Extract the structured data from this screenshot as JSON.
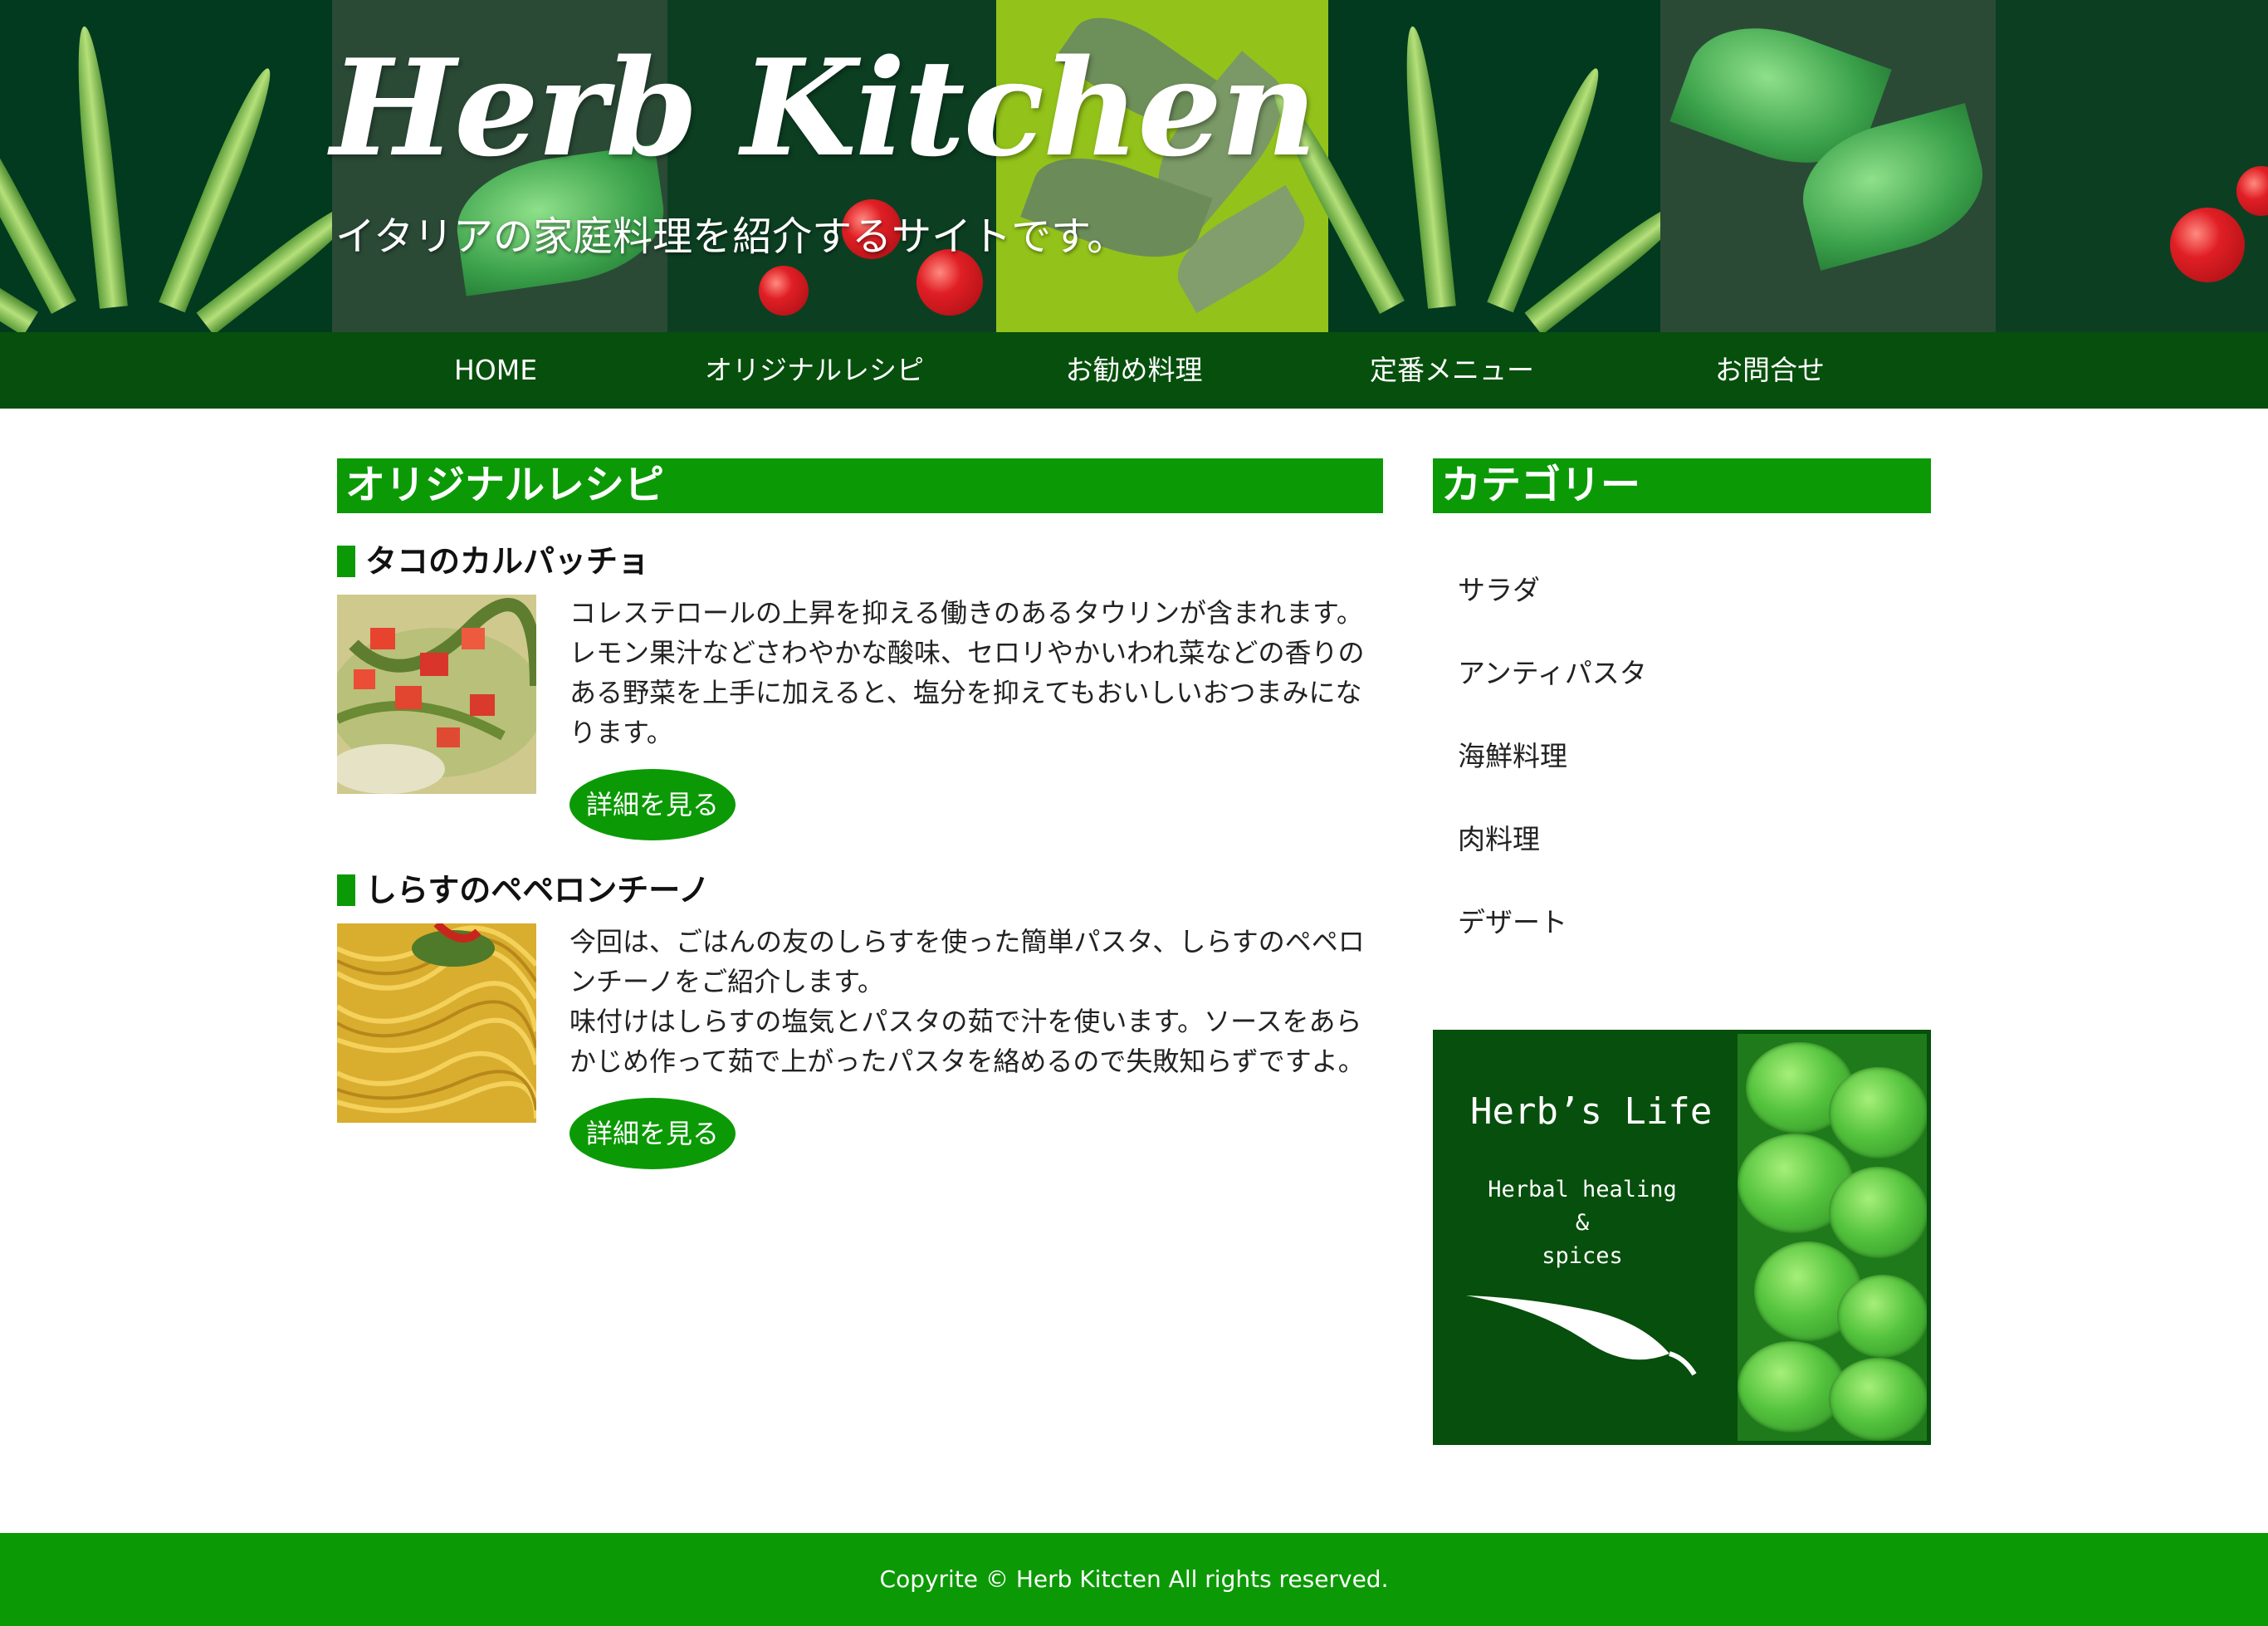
{
  "header": {
    "site_title": "Herb Kitchen",
    "tagline": "イタリアの家庭料理を紹介するサイトです。"
  },
  "nav": {
    "items": [
      {
        "label": "HOME"
      },
      {
        "label": "オリジナルレシピ"
      },
      {
        "label": "お勧め料理"
      },
      {
        "label": "定番メニュー"
      },
      {
        "label": "お問合せ"
      }
    ]
  },
  "main": {
    "heading": "オリジナルレシピ",
    "recipes": [
      {
        "title": "タコのカルパッチョ",
        "lines": [
          "コレステロールの上昇を抑える働きのあるタウリンが含まれます。",
          "レモン果汁などさわやかな酸味、セロリやかいわれ菜などの香りの",
          "ある野菜を上手に加えると、塩分を抑えてもおいしいおつまみにな",
          "ります。"
        ],
        "button": "詳細を見る"
      },
      {
        "title": "しらすのペペロンチーノ",
        "lines": [
          "今回は、ごはんの友のしらすを使った簡単パスタ、しらすのペペロ",
          "ンチーノをご紹介します。",
          "味付けはしらすの塩気とパスタの茹で汁を使います。ソースをあら",
          "かじめ作って茹で上がったパスタを絡めるので失敗知らずですよ。"
        ],
        "button": "詳細を見る"
      }
    ]
  },
  "sidebar": {
    "heading": "カテゴリー",
    "categories": [
      "サラダ",
      "アンティパスタ",
      "海鮮料理",
      "肉料理",
      "デザート"
    ],
    "banner": {
      "title": "Herb’s Life",
      "line1": "Herbal healing",
      "line2": "&",
      "line3": "spices"
    }
  },
  "footer": {
    "copyright": "Copyrite © Herb Kitcten All rights reserved."
  },
  "colors": {
    "header_bg": "#023a1f",
    "nav_bg": "#064f0c",
    "accent_green": "#0b9a05",
    "footer_bg": "#0b9a05"
  }
}
